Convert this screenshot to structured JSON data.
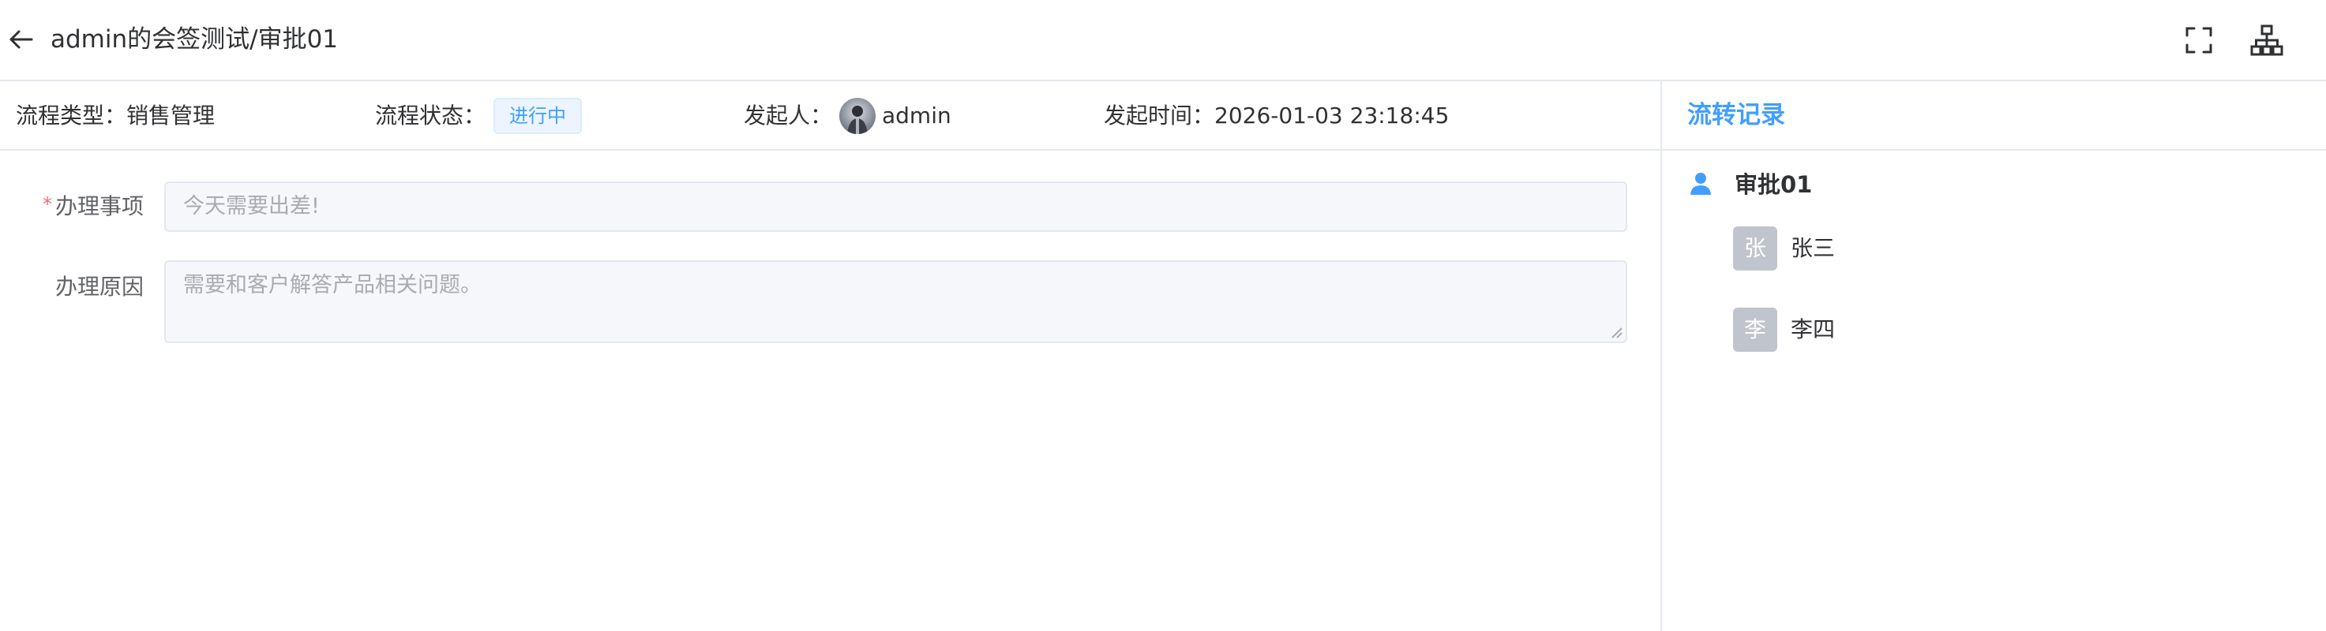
{
  "header": {
    "title": "admin的会签测试/审批01",
    "back_icon": "arrow-left-icon",
    "fullscreen_icon": "fullscreen-icon",
    "flowchart_icon": "org-chart-icon"
  },
  "info": {
    "type_label": "流程类型：",
    "type_value": "销售管理",
    "status_label": "流程状态：",
    "status_value": "进行中",
    "initiator_label": "发起人：",
    "initiator_name": "admin",
    "time_label": "发起时间：",
    "time_value": "2026-01-03 23:18:45"
  },
  "form": {
    "required_mark": "*",
    "item_label": "办理事项",
    "item_value": "今天需要出差!",
    "reason_label": "办理原因",
    "reason_value": "需要和客户解答产品相关问题。"
  },
  "record": {
    "title": "流转记录",
    "node_name": "审批01",
    "users": [
      {
        "avatar": "张",
        "name": "张三"
      },
      {
        "avatar": "李",
        "name": "李四"
      }
    ]
  },
  "colors": {
    "accent": "#409eff",
    "required": "#f56c6c",
    "border": "#e4e7ed",
    "field_bg": "#f5f7fa",
    "avatar_bg": "#c0c4cc"
  }
}
